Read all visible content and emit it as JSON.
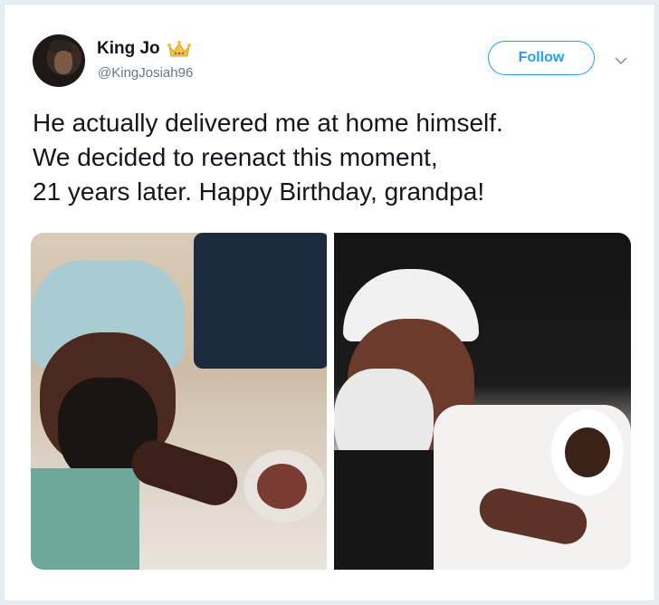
{
  "tweet": {
    "author": {
      "display_name": "King Jo",
      "handle": "@KingJosiah96",
      "avatar_icon": "user-avatar",
      "badge_icon": "crown-icon"
    },
    "follow_label": "Follow",
    "menu_icon": "chevron-down-icon",
    "text_lines": [
      "He actually delivered me at home himself.",
      "We decided to reenact this moment,",
      "21 years later. Happy Birthday, grandpa!"
    ],
    "photos": [
      {
        "icon": "photo-grandpa-with-newborn-1997"
      },
      {
        "icon": "photo-grandpa-with-grandson-reenactment"
      }
    ]
  },
  "colors": {
    "accent": "#1da1f2",
    "text": "#14171a",
    "secondary_text": "#657786",
    "crown": "#f5c33b"
  }
}
